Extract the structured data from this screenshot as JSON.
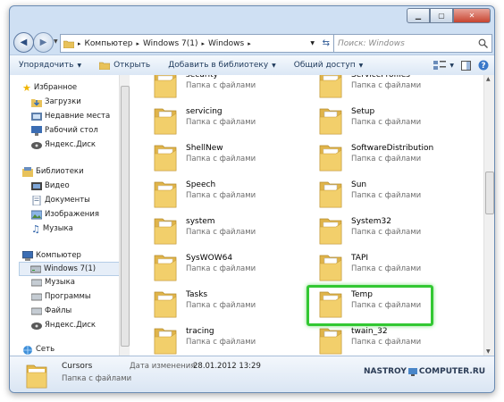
{
  "breadcrumb": [
    "Компьютер",
    "Windows 7(1)",
    "Windows"
  ],
  "search_placeholder": "Поиск: Windows",
  "toolbar": {
    "organize": "Упорядочить",
    "open": "Открыть",
    "add_to_library": "Добавить в библиотеку",
    "share": "Общий доступ"
  },
  "nav": {
    "favorites": "Избранное",
    "downloads": "Загрузки",
    "recent": "Недавние места",
    "desktop": "Рабочий стол",
    "yadisk1": "Яндекс.Диск",
    "libraries": "Библиотеки",
    "video": "Видео",
    "documents": "Документы",
    "images": "Изображения",
    "music1": "Музыка",
    "computer": "Компьютер",
    "win7": "Windows 7(1)",
    "music2": "Музыка",
    "programs": "Программы",
    "files": "Файлы",
    "yadisk2": "Яндекс.Диск",
    "network": "Сеть"
  },
  "folder_type": "Папка с файлами",
  "files_left": [
    "security",
    "servicing",
    "ShellNew",
    "Speech",
    "system",
    "SysWOW64",
    "Tasks",
    "tracing"
  ],
  "files_right": [
    "ServiceProfiles",
    "Setup",
    "SoftwareDistribution",
    "Sun",
    "System32",
    "TAPI",
    "Temp",
    "twain_32"
  ],
  "status": {
    "name": "Cursors",
    "type": "Папка с файлами",
    "date_label": "Дата изменения:",
    "date_value": "28.01.2012 13:29"
  },
  "watermark": "NASTROY",
  "watermark2": "COMPUTER.RU",
  "colors": {
    "highlight": "#32c832",
    "folder": "#f2cf6b"
  }
}
